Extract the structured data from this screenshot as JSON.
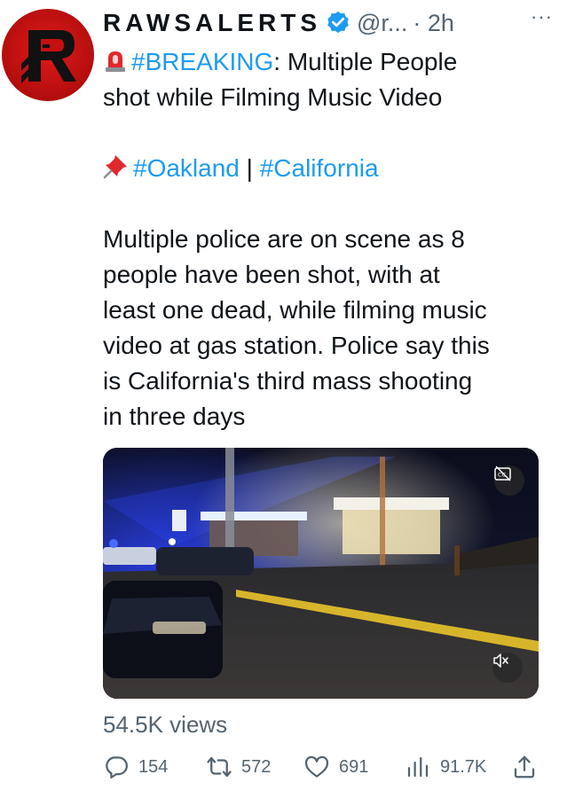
{
  "tweet": {
    "display_name": "RAWSALERTS",
    "handle": "@r...",
    "timestamp": "· 2h",
    "more_label": "···",
    "lines": {
      "l1_tag": "#BREAKING",
      "l1_rest": ": Multiple People",
      "l2": "shot while Filming Music Video",
      "l3_tag1": "#Oakland",
      "l3_sep": " | ",
      "l3_tag2": "#California",
      "body1": "Multiple police are on scene as 8",
      "body2": "people have been shot, with at",
      "body3": "least one dead, while filming music",
      "body4": "video at gas station. Police say this",
      "body5": "is California's third mass shooting",
      "body6": "in three days"
    },
    "views_label": "54.5K views",
    "actions": {
      "replies": "154",
      "retweets": "572",
      "likes": "691",
      "analytics": "91.7K"
    }
  },
  "icons": {
    "verified": "verified-badge-icon",
    "siren": "police-light-emoji",
    "pin": "pushpin-emoji",
    "reply": "reply-icon",
    "retweet": "retweet-icon",
    "like": "heart-icon",
    "analytics": "analytics-icon",
    "share": "share-icon",
    "captions": "captions-icon",
    "mute": "muted-speaker-icon"
  },
  "colors": {
    "link": "#1d9bf0",
    "secondary_text": "#536471",
    "avatar_red": "#c41010"
  }
}
